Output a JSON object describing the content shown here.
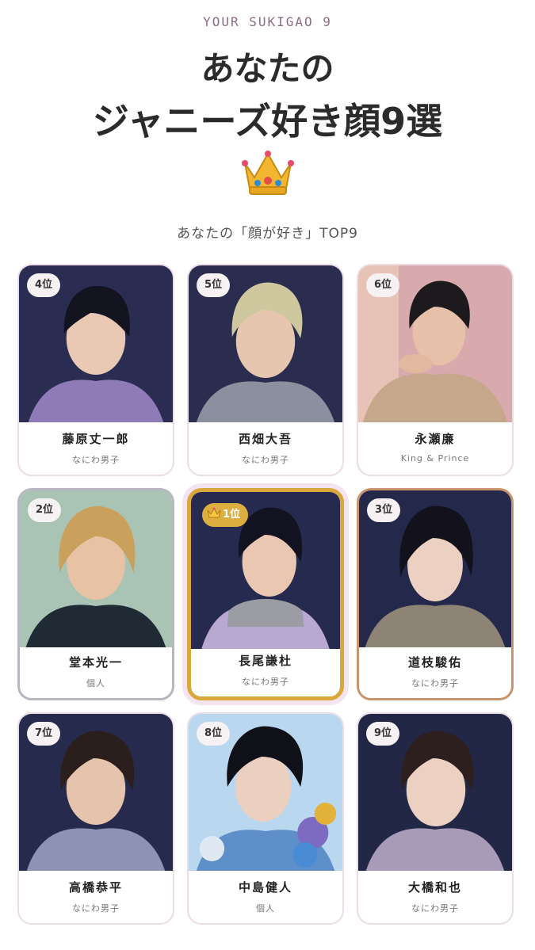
{
  "header": {
    "eyebrow": "YOUR SUKIGAO 9",
    "title_line1": "あなたの",
    "title_line2": "ジャニーズ好き顔9選",
    "crown_icon": "crown-icon",
    "subtitle": "あなたの「顔が好き」TOP9"
  },
  "cards": [
    {
      "rank": "4位",
      "name": "藤原丈一郎",
      "group": "なにわ男子",
      "bg": "#2a2c52",
      "accent": "#8f7bb8"
    },
    {
      "rank": "5位",
      "name": "西畑大吾",
      "group": "なにわ男子",
      "bg": "#2b2d4f",
      "accent": "#8b8f9e"
    },
    {
      "rank": "6位",
      "name": "永瀬廉",
      "group": "King & Prince",
      "bg": "#d8a9ad",
      "accent": "#c6a78c"
    },
    {
      "rank": "2位",
      "name": "堂本光一",
      "group": "個人",
      "bg": "#a9c3b5",
      "accent": "#1f2a34"
    },
    {
      "rank": "1位",
      "name": "長尾謙杜",
      "group": "なにわ男子",
      "bg": "#272a4f",
      "accent": "#b7a9cf"
    },
    {
      "rank": "3位",
      "name": "道枝駿佑",
      "group": "なにわ男子",
      "bg": "#24284a",
      "accent": "#8e8476"
    },
    {
      "rank": "7位",
      "name": "高橋恭平",
      "group": "なにわ男子",
      "bg": "#262a4d",
      "accent": "#8d93b4"
    },
    {
      "rank": "8位",
      "name": "中島健人",
      "group": "個人",
      "bg": "#b9d7ef",
      "accent": "#7d6bc2"
    },
    {
      "rank": "9位",
      "name": "大橋和也",
      "group": "なにわ男子",
      "bg": "#232746",
      "accent": "#a89bb8"
    }
  ]
}
